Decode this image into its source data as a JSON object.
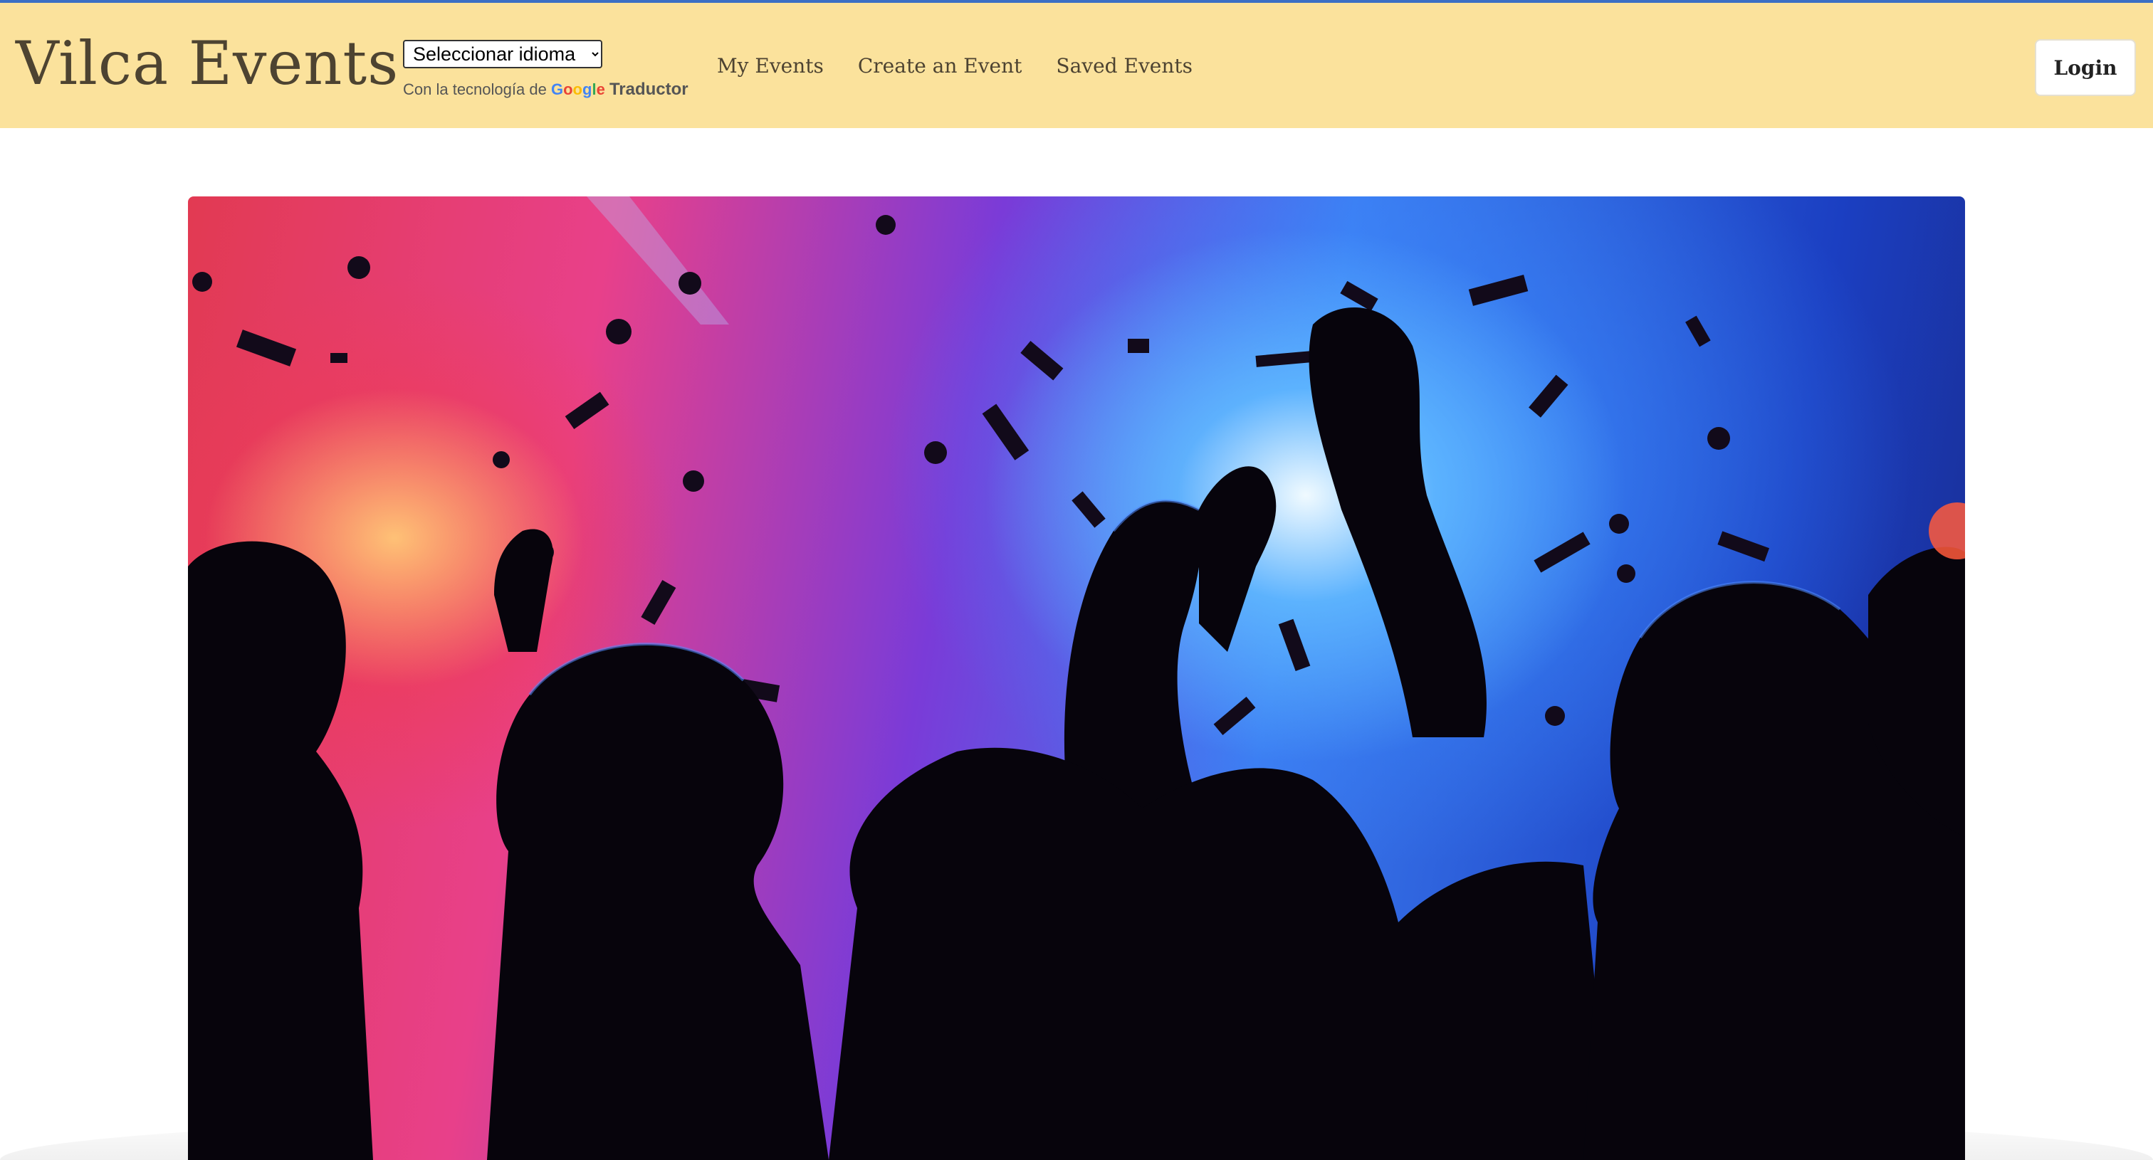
{
  "navbar": {
    "brand": "Vilca Events",
    "translate": {
      "select_value": "Seleccionar idioma",
      "powered_prefix": "Con la tecnología de",
      "google_letters": [
        "G",
        "o",
        "o",
        "g",
        "l",
        "e"
      ],
      "powered_suffix": "Traductor"
    },
    "links": [
      {
        "label": "My Events"
      },
      {
        "label": "Create an Event"
      },
      {
        "label": "Saved Events"
      }
    ],
    "login_label": "Login"
  },
  "colors": {
    "navbar_bg": "#fbe29c",
    "top_accent": "#3b6fc4",
    "brand_text": "#4d4331"
  },
  "hero": {
    "image_subject": "party-crowd-confetti"
  }
}
